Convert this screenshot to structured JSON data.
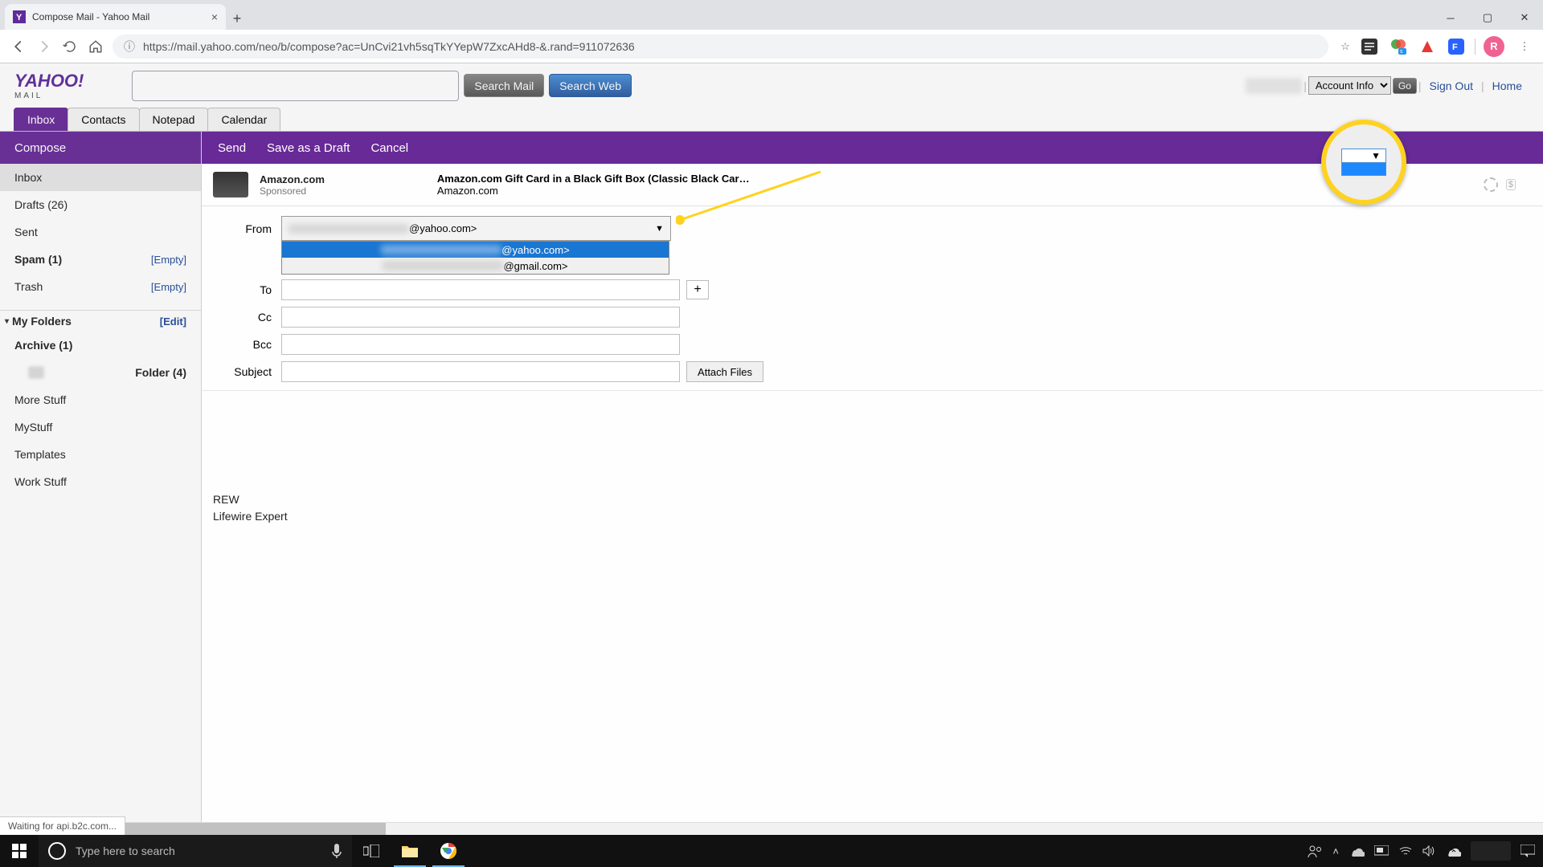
{
  "browser": {
    "tab_title": "Compose Mail - Yahoo Mail",
    "url": "https://mail.yahoo.com/neo/b/compose?ac=UnCvi21vh5sqTkYYepW7ZxcAHd8-&.rand=911072636",
    "status": "Waiting for api.b2c.com...",
    "avatar_letter": "R"
  },
  "header": {
    "logo_main": "YAHOO!",
    "logo_sub": "MAIL",
    "search_mail": "Search Mail",
    "search_web": "Search Web",
    "account_info": "Account Info",
    "go": "Go",
    "sign_out": "Sign Out",
    "home": "Home"
  },
  "tabs": {
    "inbox": "Inbox",
    "contacts": "Contacts",
    "notepad": "Notepad",
    "calendar": "Calendar"
  },
  "sidebar": {
    "compose": "Compose",
    "inbox": "Inbox",
    "drafts": "Drafts (26)",
    "sent": "Sent",
    "spam": "Spam (1)",
    "spam_action": "[Empty]",
    "trash": "Trash",
    "trash_action": "[Empty]",
    "my_folders": "My Folders",
    "edit": "[Edit]",
    "archive": "Archive (1)",
    "folder4": "Folder (4)",
    "more_stuff": "More Stuff",
    "mystuff": "MyStuff",
    "templates": "Templates",
    "work_stuff": "Work Stuff"
  },
  "actions": {
    "send": "Send",
    "save_draft": "Save as a Draft",
    "cancel": "Cancel"
  },
  "ad": {
    "title": "Amazon.com",
    "sponsor": "Sponsored",
    "headline": "Amazon.com Gift Card in a Black Gift Box (Classic Black Car…",
    "domain": "Amazon.com"
  },
  "form": {
    "from_label": "From",
    "to_label": "To",
    "cc_label": "Cc",
    "bcc_label": "Bcc",
    "subject_label": "Subject",
    "from_suffix": "@yahoo.com>",
    "opt1_suffix": "@yahoo.com>",
    "opt2_suffix": "@gmail.com>",
    "plus": "+",
    "attach": "Attach Files"
  },
  "body": {
    "line1": "REW",
    "line2": "Lifewire Expert"
  },
  "taskbar": {
    "search_placeholder": "Type here to search"
  }
}
